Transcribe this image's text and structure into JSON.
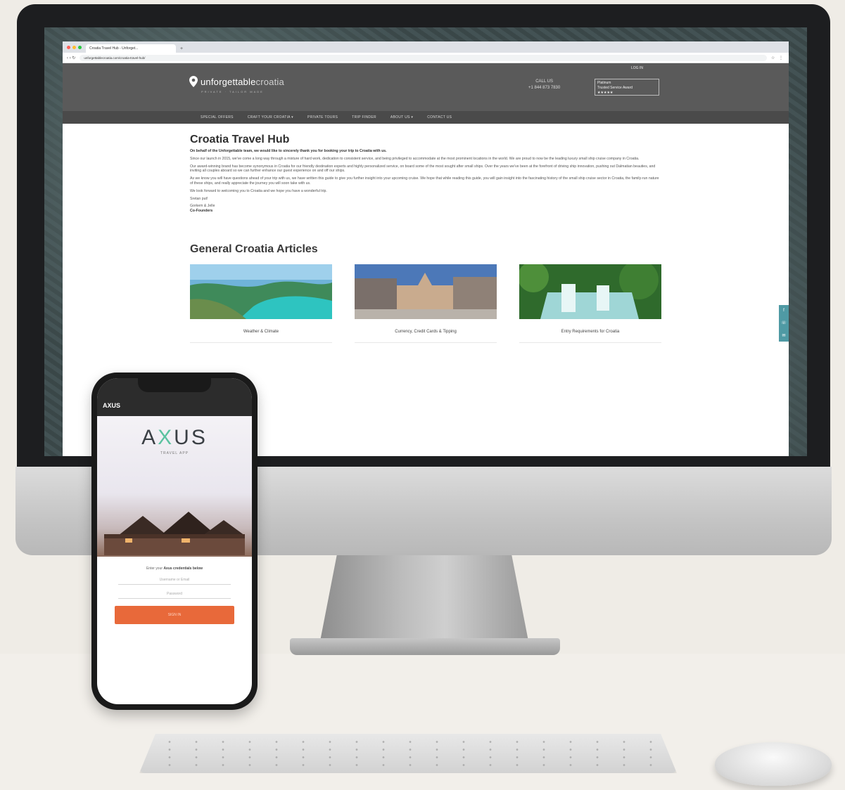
{
  "browser": {
    "tab_title": "Croatia Travel Hub - Unforget...",
    "new_tab": "+",
    "url": "unforgettablecroatia.com/croatia-travel-hub/",
    "nav_glyphs": "‹ › ↻"
  },
  "site": {
    "logo_main": "unforgettable",
    "logo_accent": "croatia",
    "logo_tagline": "PRIVATE · TAILOR MADE",
    "login": "LOG IN",
    "call_label": "CALL US",
    "call_number": "+1 844 873 7830",
    "award_line1": "Platinum",
    "award_line2": "Trusted Service Award",
    "award_stars": "★★★★★",
    "nav": [
      "SPECIAL OFFERS",
      "CRAFT YOUR CROATIA ▾",
      "PRIVATE TOURS",
      "TRIP FINDER",
      "ABOUT US ▾",
      "CONTACT US"
    ]
  },
  "content": {
    "title": "Croatia Travel Hub",
    "intro_bold": "On behalf of the Unforgettable team, we would like to sincerely thank you for booking your trip to Croatia with us.",
    "para1": "Since our launch in 2015, we've come a long way through a mixture of hard work, dedication to consistent service, and being privileged to accommodate at the most prominent locations in the world. We are proud to now be the leading luxury small ship cruise company in Croatia.",
    "para2": "Our award-winning brand has become synonymous in Croatia for our friendly destination experts and highly personalized service, on board some of the most sought after small ships. Over the years we've been at the forefront of driving ship innovation, pushing out Dalmatian beauties, and inviting all couples aboard so we can further enhance our guest experience on and off our ships.",
    "para3": "As we know you will have questions ahead of your trip with us, we have written this guide to give you further insight into your upcoming cruise. We hope that while reading this guide, you will gain insight into the fascinating history of the small ship cruise sector in Croatia, the family-run nature of these ships, and really appreciate the journey you will soon take with us.",
    "para4": "We look forward to welcoming you to Croatia and we hope you have a wonderful trip.",
    "signoff": "Sretan put!",
    "signature": "Gorkem & Jelle",
    "signature_role": "Co-Founders",
    "articles_title": "General Croatia Articles",
    "articles": [
      {
        "label": "Weather & Climate",
        "image": "coastline-photo"
      },
      {
        "label": "Currency, Credit Cards & Tipping",
        "image": "old-town-square-photo"
      },
      {
        "label": "Entry Requirements for Croatia",
        "image": "waterfalls-photo"
      }
    ],
    "side_widget_icons": [
      "f",
      "☏",
      "✉"
    ]
  },
  "phone": {
    "app_bar_title": "AXUS",
    "logo_a": "A",
    "logo_x": "X",
    "logo_us": "US",
    "logo_subtitle": "TRAVEL APP",
    "prompt_prefix": "Enter your",
    "prompt_bold": "Axus credentials below",
    "field1_placeholder": "Username or Email",
    "field2_placeholder": "Password",
    "button_label": "SIGN IN"
  },
  "colors": {
    "site_header": "#5a5a5a",
    "nav_bar": "#4a4a4a",
    "axus_accent": "#5bc2a0",
    "cta_orange": "#e8693a",
    "side_widget": "#4f9aa4"
  }
}
